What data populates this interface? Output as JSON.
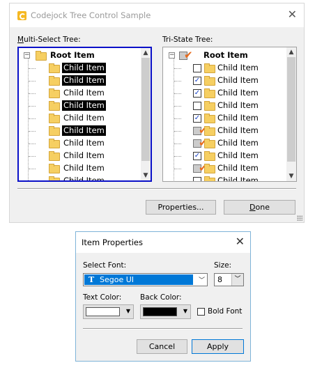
{
  "main_window": {
    "title": "Codejock Tree Control Sample",
    "multi_label": "Multi-Select Tree:",
    "tri_label": "Tri-State Tree:",
    "properties_btn": "Properties...",
    "done_btn": "Done"
  },
  "left_tree": {
    "root": "Root Item",
    "items": [
      {
        "label": "Child Item",
        "selected": true
      },
      {
        "label": "Child Item",
        "selected": true
      },
      {
        "label": "Child Item",
        "selected": false
      },
      {
        "label": "Child Item",
        "selected": true
      },
      {
        "label": "Child Item",
        "selected": false
      },
      {
        "label": "Child Item",
        "selected": true
      },
      {
        "label": "Child Item",
        "selected": false
      },
      {
        "label": "Child Item",
        "selected": false
      },
      {
        "label": "Child Item",
        "selected": false
      },
      {
        "label": "Child Item",
        "selected": false
      }
    ]
  },
  "right_tree": {
    "root": "Root Item",
    "items": [
      {
        "label": "Child Item",
        "state": "unchecked"
      },
      {
        "label": "Child Item",
        "state": "checked"
      },
      {
        "label": "Child Item",
        "state": "checked"
      },
      {
        "label": "Child Item",
        "state": "unchecked"
      },
      {
        "label": "Child Item",
        "state": "checked"
      },
      {
        "label": "Child Item",
        "state": "partial"
      },
      {
        "label": "Child Item",
        "state": "partial"
      },
      {
        "label": "Child Item",
        "state": "checked"
      },
      {
        "label": "Child Item",
        "state": "partial"
      },
      {
        "label": "Child Item",
        "state": "unchecked"
      }
    ]
  },
  "dialog": {
    "title": "Item Properties",
    "select_font_label": "Select Font:",
    "font_value": "Segoe UI",
    "font_icon": "T",
    "size_label": "Size:",
    "size_value": "8",
    "text_color_label": "Text Color:",
    "back_color_label": "Back Color:",
    "bold_label": "Bold Font",
    "text_color": "#ffffff",
    "back_color": "#000000",
    "cancel_btn": "Cancel",
    "apply_btn": "Apply"
  },
  "colors": {
    "selection": "#000000",
    "accent": "#0078d7",
    "focus_border": "#0a10c8",
    "tri_check": "#e86b1c"
  }
}
